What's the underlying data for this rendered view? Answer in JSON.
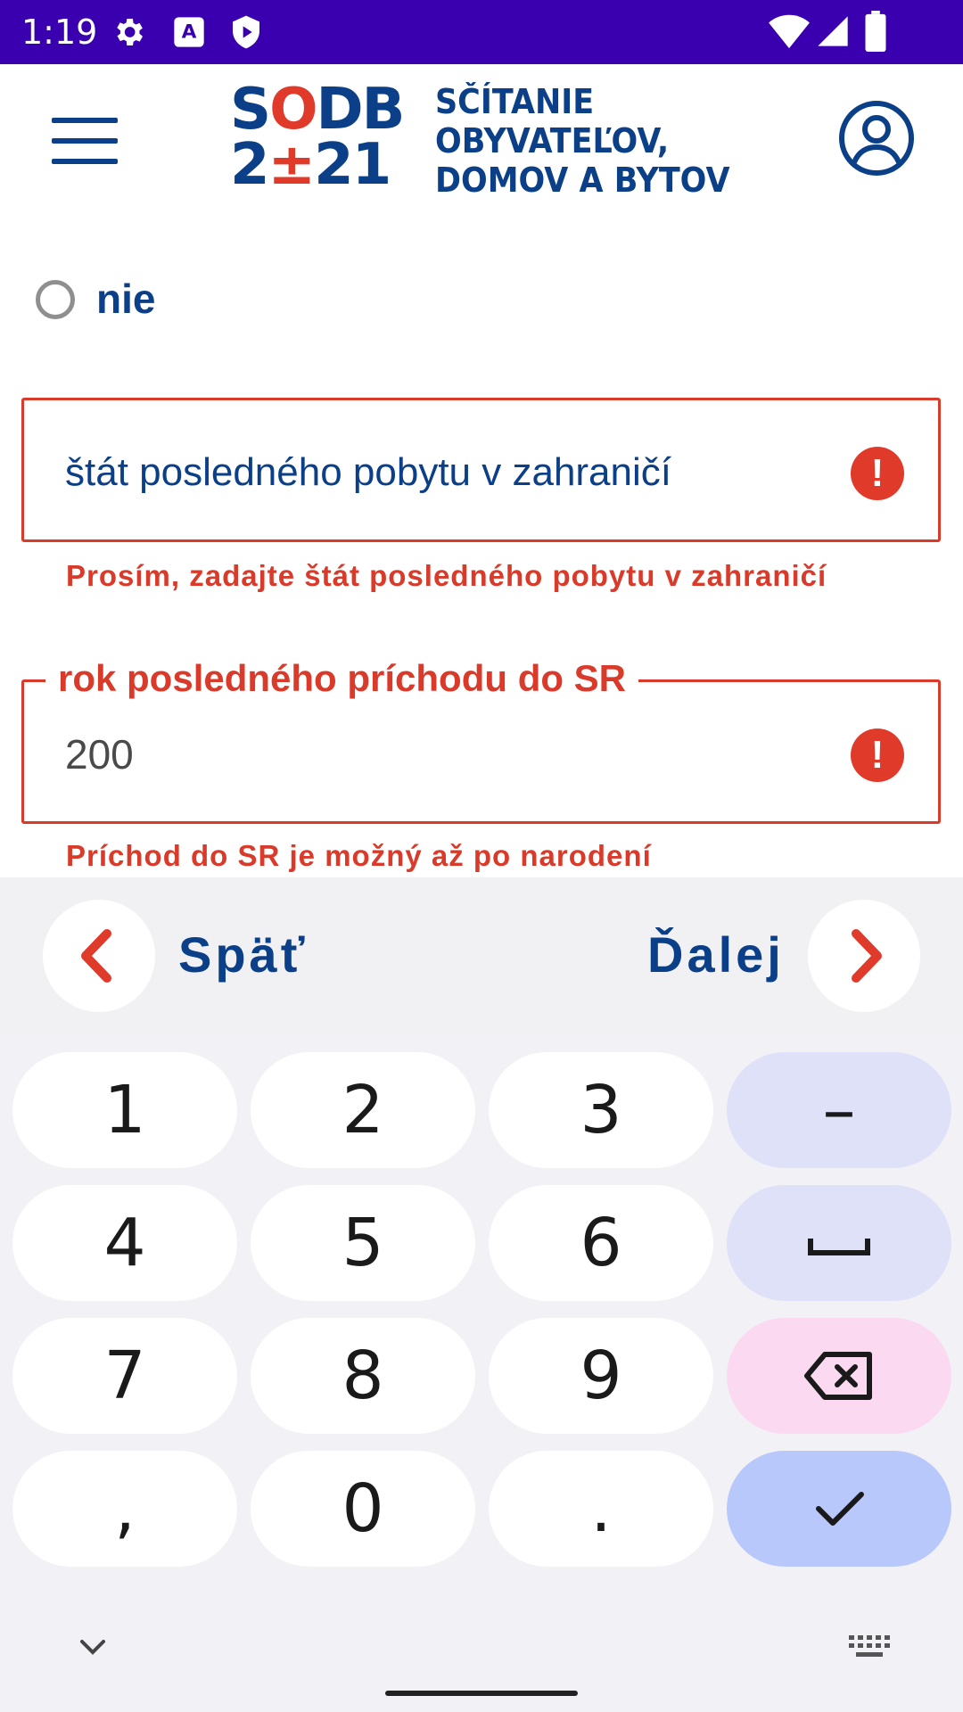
{
  "status_bar": {
    "time": "1:19",
    "icons": [
      "gear-icon",
      "keyboard-a-icon",
      "play-shield-icon",
      "wifi-icon",
      "signal-icon",
      "battery-icon"
    ]
  },
  "header": {
    "logo_line1": {
      "a": "S",
      "b": "O",
      "c": "DB"
    },
    "logo_line2": {
      "a": "2",
      "b": "±",
      "c": "21"
    },
    "logo_text": [
      "SČÍTANIE",
      "OBYVATEĽOV,",
      "DOMOV A BYTOV"
    ],
    "menu_icon": "hamburger-icon",
    "profile_icon": "user-profile-icon"
  },
  "form": {
    "radio_option_label": "nie",
    "field1": {
      "placeholder": "štát posledného pobytu v zahraničí",
      "error": "Prosím, zadajte štát posledného pobytu v zahraničí"
    },
    "field2": {
      "label": "rok posledného príchodu do SR",
      "value": "200",
      "error": "Príchod do SR je možný až po narodení"
    },
    "error_icon_glyph": "!"
  },
  "nav": {
    "back_label": "Späť",
    "next_label": "Ďalej"
  },
  "keyboard": {
    "keys": [
      "1",
      "2",
      "3",
      "–",
      "4",
      "5",
      "6",
      "␣",
      "7",
      "8",
      "9",
      "⌫",
      ",",
      "0",
      ".",
      "✓"
    ]
  },
  "colors": {
    "status_bar": "#3a00b0",
    "brand_blue": "#0b3f88",
    "brand_red": "#e03a2a",
    "key_func": "#dfe1f8",
    "key_delete": "#fbd9f1",
    "key_done": "#b9c8fb"
  }
}
